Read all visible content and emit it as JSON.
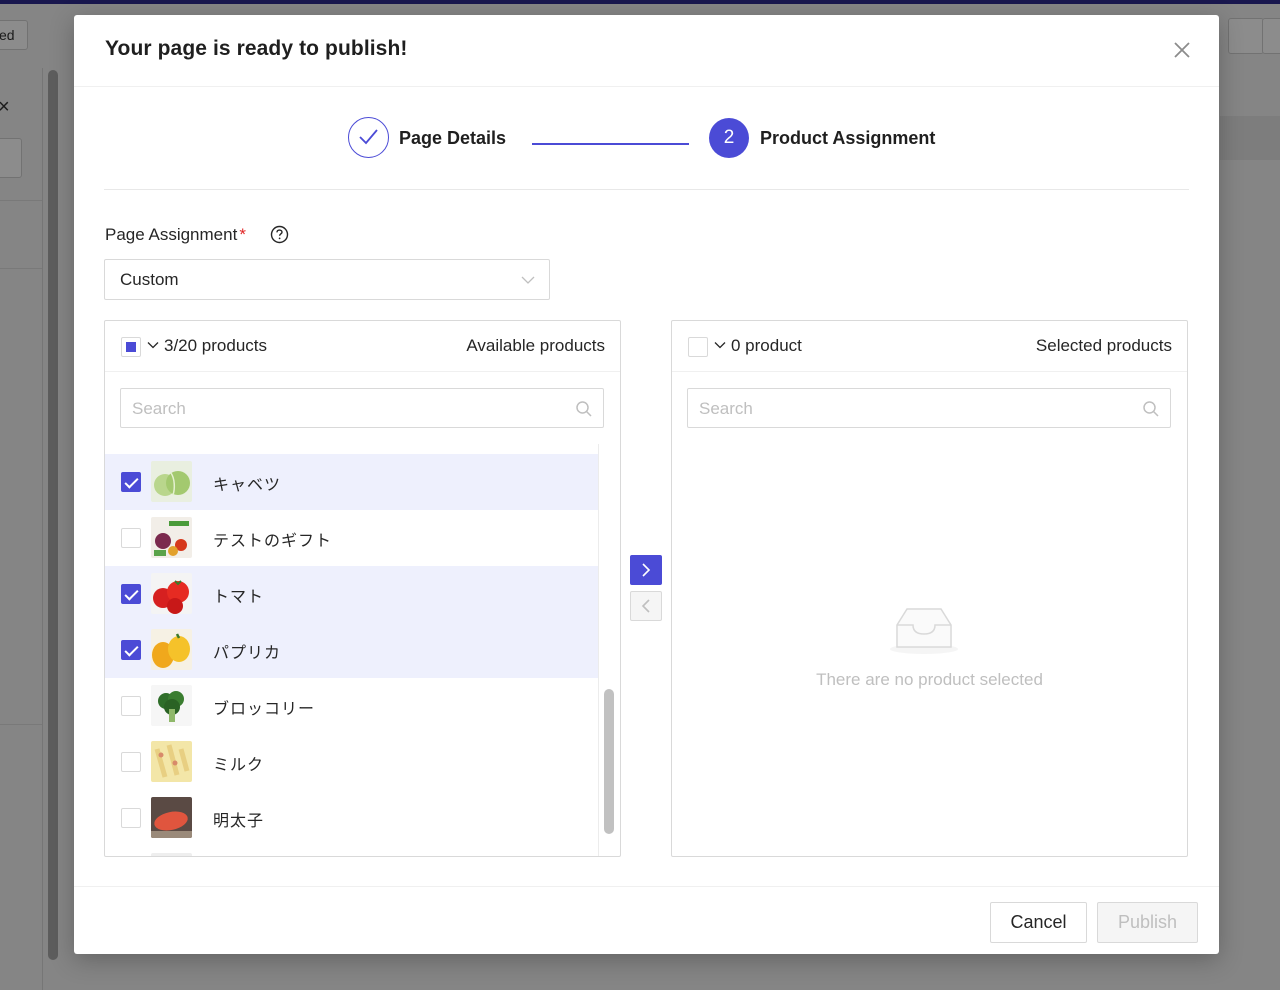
{
  "background": {
    "fragment_button_text": "ed"
  },
  "modal": {
    "title": "Your page is ready to publish!"
  },
  "steps": [
    {
      "label": "Page Details",
      "status": "done"
    },
    {
      "number": "2",
      "label": "Product Assignment",
      "status": "active"
    }
  ],
  "page_assignment": {
    "label": "Page Assignment",
    "required_mark": "*",
    "value": "Custom"
  },
  "available": {
    "count": "3/20 products",
    "title": "Available products",
    "search_placeholder": "Search",
    "items": [
      {
        "name": "キャベツ",
        "checked": true
      },
      {
        "name": "テストのギフト",
        "checked": false
      },
      {
        "name": "トマト",
        "checked": true
      },
      {
        "name": "パプリカ",
        "checked": true
      },
      {
        "name": "ブロッコリー",
        "checked": false
      },
      {
        "name": "ミルク",
        "checked": false
      },
      {
        "name": "明太子",
        "checked": false
      }
    ]
  },
  "selected": {
    "count": "0 product",
    "title": "Selected products",
    "search_placeholder": "Search",
    "empty_text": "There are no product selected"
  },
  "footer": {
    "cancel_label": "Cancel",
    "publish_label": "Publish"
  },
  "colors": {
    "accent": "#4b4bd6",
    "selected_row": "#eef0fd"
  }
}
